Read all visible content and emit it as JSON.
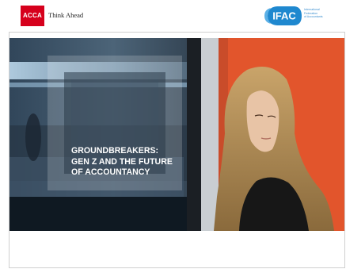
{
  "header": {
    "acca_logo_text": "ACCA",
    "acca_tagline": "Think Ahead",
    "ifac_logo_text": "IFAC",
    "ifac_sub_lines": [
      "International",
      "Federation",
      "of Accountants"
    ]
  },
  "cover": {
    "title_lines": [
      "GROUNDBREAKERS:",
      "GEN Z AND THE FUTURE",
      "OF ACCOUNTANCY"
    ]
  },
  "colors": {
    "acca_red": "#d6001c",
    "ifac_blue": "#1f88cf",
    "orange_wall": "#e2552c"
  }
}
